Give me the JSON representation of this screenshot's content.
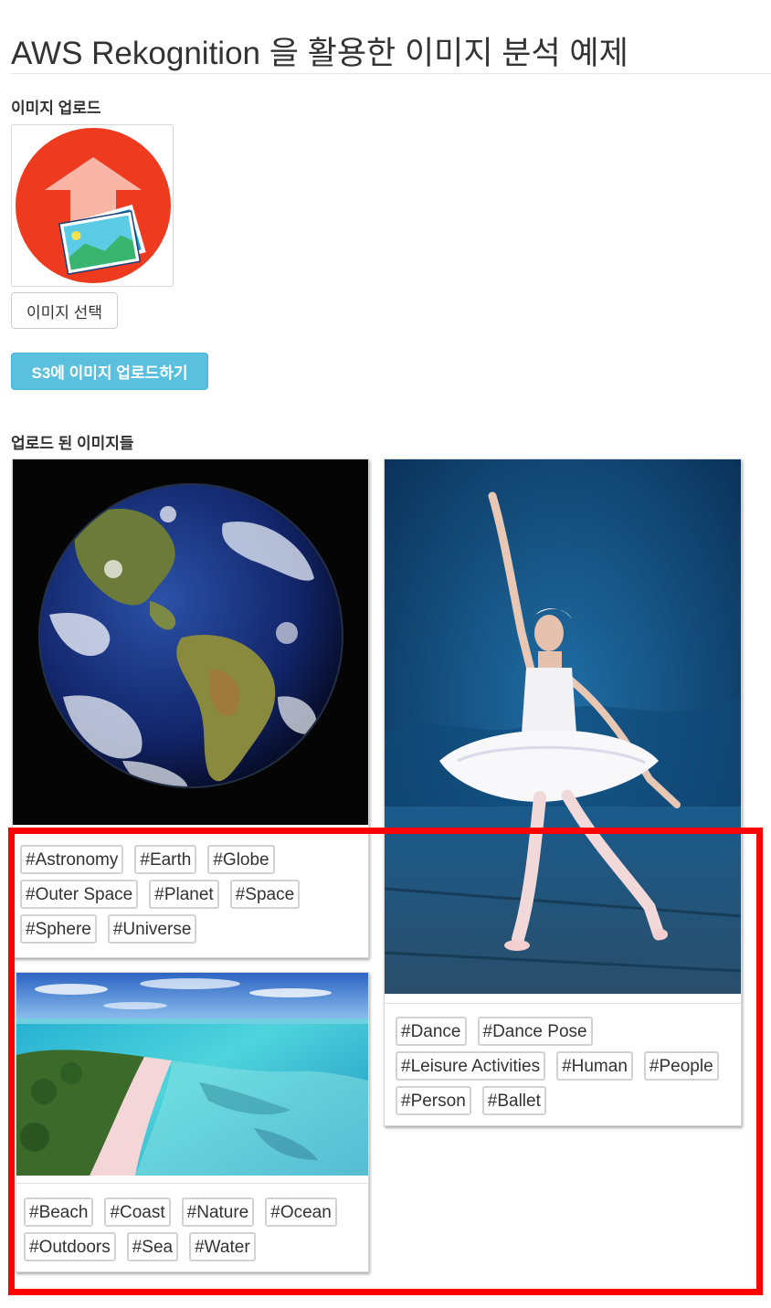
{
  "header": {
    "title": "AWS Rekognition 을 활용한 이미지 분석 예제"
  },
  "upload": {
    "label": "이미지 업로드",
    "preview_icon": "upload-image-icon",
    "select_button": "이미지 선택",
    "upload_button": "S3에 이미지 업로드하기"
  },
  "gallery": {
    "label": "업로드 된 이미지들",
    "cards": [
      {
        "image": "earth-photo",
        "tags": [
          "#Astronomy",
          "#Earth",
          "#Globe",
          "#Outer Space",
          "#Planet",
          "#Space",
          "#Sphere",
          "#Universe"
        ]
      },
      {
        "image": "beach-photo",
        "tags": [
          "#Beach",
          "#Coast",
          "#Nature",
          "#Ocean",
          "#Outdoors",
          "#Sea",
          "#Water"
        ]
      },
      {
        "image": "ballet-photo",
        "tags": [
          "#Dance",
          "#Dance Pose",
          "#Leisure Activities",
          "#Human",
          "#People",
          "#Person",
          "#Ballet"
        ]
      }
    ]
  },
  "colors": {
    "info_button": "#5bc0de",
    "highlight": "#ff0000",
    "icon_circle": "#ee3b1f"
  }
}
